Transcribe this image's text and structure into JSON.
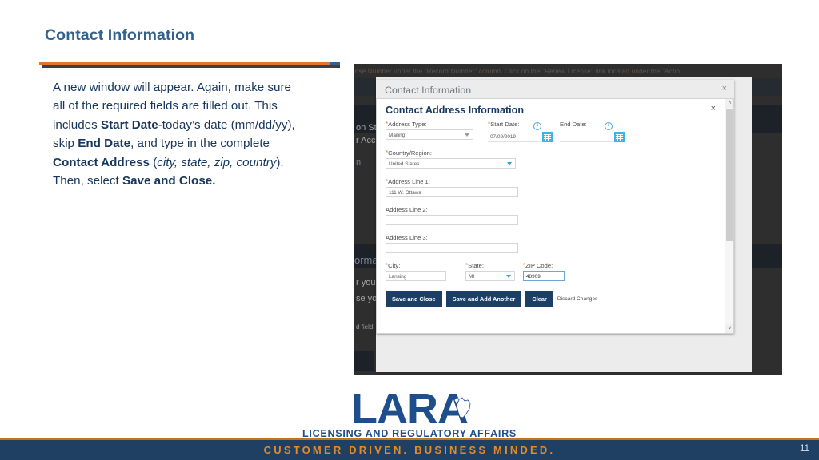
{
  "slide": {
    "title": "Contact Information",
    "page_number": "11",
    "accent_orange": "#e1762a",
    "title_blue": "#33618d",
    "body_navy": "#17365d"
  },
  "body": {
    "line1": "A new window will appear.  Again, make sure",
    "line2": "all of the required fields are filled out.  This",
    "line3_pre": "includes ",
    "line3_bold": "Start Date",
    "line3_post": "-today’s date (mm/dd/yy),",
    "line4_pre": "skip ",
    "line4_bold": "End Date",
    "line4_post": ", and type in the complete",
    "line5_bold": "Contact Address",
    "line5_mid": " (",
    "line5_italic": "city, state, zip, country",
    "line5_post": ").",
    "line6_pre": "Then, select ",
    "line6_bold": "Save and Close."
  },
  "screenshot": {
    "background_text_top": "ense Number under the \"Record Number\" column.  Click on the \"Renew License\" link located under the \"Actio",
    "background_left_1": "on St",
    "background_left_2": "r Acc",
    "background_left_3": "n",
    "background_left_4": "orma",
    "background_left_5": "r you",
    "background_left_6": "se yo",
    "background_left_7": "d field",
    "outer_modal": {
      "title": "Contact Information",
      "close_icon": "close-icon",
      "close_glyph": "×"
    },
    "inner_modal": {
      "title": "Contact Address Information",
      "close_glyph": "×",
      "scrollbar": {
        "up_glyph": "˄",
        "down_glyph": "˅"
      },
      "fields": {
        "address_type": {
          "label": "Address Type:",
          "required": true,
          "value": "Mailing"
        },
        "start_date": {
          "label": "Start Date:",
          "required": true,
          "value": "07/09/2019",
          "calendar_icon": "calendar-icon",
          "info_icon": "info-icon",
          "info_glyph": "i"
        },
        "end_date": {
          "label": "End Date:",
          "required": false,
          "value": "",
          "calendar_icon": "calendar-icon",
          "info_icon": "info-icon",
          "info_glyph": "i"
        },
        "country_region": {
          "label": "Country/Region:",
          "required": true,
          "value": "United States"
        },
        "address_line_1": {
          "label": "Address Line 1:",
          "required": true,
          "value": "111 W. Ottawa"
        },
        "address_line_2": {
          "label": "Address Line 2:",
          "required": false,
          "value": ""
        },
        "address_line_3": {
          "label": "Address Line 3:",
          "required": false,
          "value": ""
        },
        "city": {
          "label": "City:",
          "required": true,
          "value": "Lansing"
        },
        "state": {
          "label": "State:",
          "required": true,
          "value": "MI"
        },
        "zip_code": {
          "label": "ZIP Code:",
          "required": true,
          "value": "48909",
          "focused": true
        }
      },
      "buttons": {
        "save_and_close": "Save and Close",
        "save_and_add_another": "Save and Add Another",
        "clear": "Clear",
        "discard_changes": "Discard Changes"
      }
    }
  },
  "logo": {
    "wordmark": "LARA",
    "subtitle": "LICENSING AND REGULATORY AFFAIRS",
    "color": "#1f4e8c"
  },
  "footer": {
    "tagline": "CUSTOMER DRIVEN.  BUSINESS MINDED.",
    "background": "#1f3f63",
    "text_color": "#e58a2a",
    "rule_color": "#c0761f"
  }
}
